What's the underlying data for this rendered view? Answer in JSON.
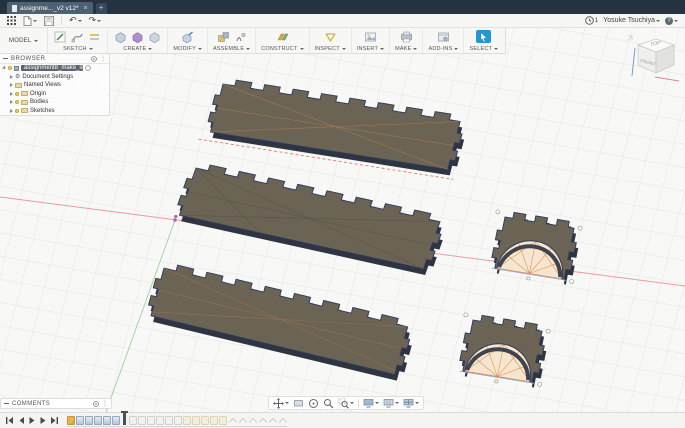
{
  "window": {
    "tab_title": "assignme..._v2 v12*"
  },
  "icons": {
    "close": "×",
    "plus": "+",
    "undo": "↶",
    "redo": "↷",
    "gear": "⚙",
    "help": "?",
    "dots": "⋮"
  },
  "topbar": {
    "clock_count": "1",
    "user": "Yosuke Tsuchiya"
  },
  "toolbar": {
    "workspace": "MODEL",
    "groups": [
      {
        "label": "SKETCH"
      },
      {
        "label": "CREATE"
      },
      {
        "label": "MODIFY"
      },
      {
        "label": "ASSEMBLE"
      },
      {
        "label": "CONSTRUCT"
      },
      {
        "label": "INSPECT"
      },
      {
        "label": "INSERT"
      },
      {
        "label": "MAKE"
      },
      {
        "label": "ADD-INS"
      },
      {
        "label": "SELECT"
      }
    ]
  },
  "browser": {
    "title": "BROWSER",
    "root": "assignment8_make_somethin...",
    "items": [
      {
        "label": "Document Settings"
      },
      {
        "label": "Named Views"
      },
      {
        "label": "Origin"
      },
      {
        "label": "Bodies"
      },
      {
        "label": "Sketches"
      }
    ]
  },
  "viewcube": {
    "top": "TOP",
    "front": "FRONT"
  },
  "comments": {
    "title": "COMMENTS"
  },
  "timeline": {
    "features": [
      {
        "kind": "sketch",
        "state": "done"
      },
      {
        "kind": "extrude",
        "state": "done"
      },
      {
        "kind": "extrude",
        "state": "done"
      },
      {
        "kind": "extrude",
        "state": "done"
      },
      {
        "kind": "extrude",
        "state": "done"
      },
      {
        "kind": "extrude",
        "state": "done"
      },
      {
        "kind": "marker"
      },
      {
        "kind": "sketch",
        "state": "future"
      },
      {
        "kind": "sketch",
        "state": "future"
      },
      {
        "kind": "sketch",
        "state": "future"
      },
      {
        "kind": "sketch",
        "state": "future"
      },
      {
        "kind": "sketch",
        "state": "future"
      },
      {
        "kind": "sketch",
        "state": "future"
      },
      {
        "kind": "box",
        "state": "future"
      },
      {
        "kind": "box",
        "state": "future"
      },
      {
        "kind": "box",
        "state": "future"
      },
      {
        "kind": "box",
        "state": "future"
      },
      {
        "kind": "box",
        "state": "future"
      },
      {
        "kind": "chevron",
        "state": "future"
      },
      {
        "kind": "chevron",
        "state": "future"
      },
      {
        "kind": "chevron",
        "state": "future"
      },
      {
        "kind": "chevron",
        "state": "future"
      },
      {
        "kind": "chevron",
        "state": "future"
      },
      {
        "kind": "chevron",
        "state": "future"
      }
    ]
  },
  "colors": {
    "titlebar": "#253340",
    "accent_blue": "#2596d1",
    "panel_face": "#6b6353",
    "panel_edge": "#2c3a63",
    "sketch_orange": "#d8813f",
    "sketch_fill": "#f6e6d0",
    "axis_red": "#e89b9b",
    "axis_green": "#9fd09f"
  }
}
